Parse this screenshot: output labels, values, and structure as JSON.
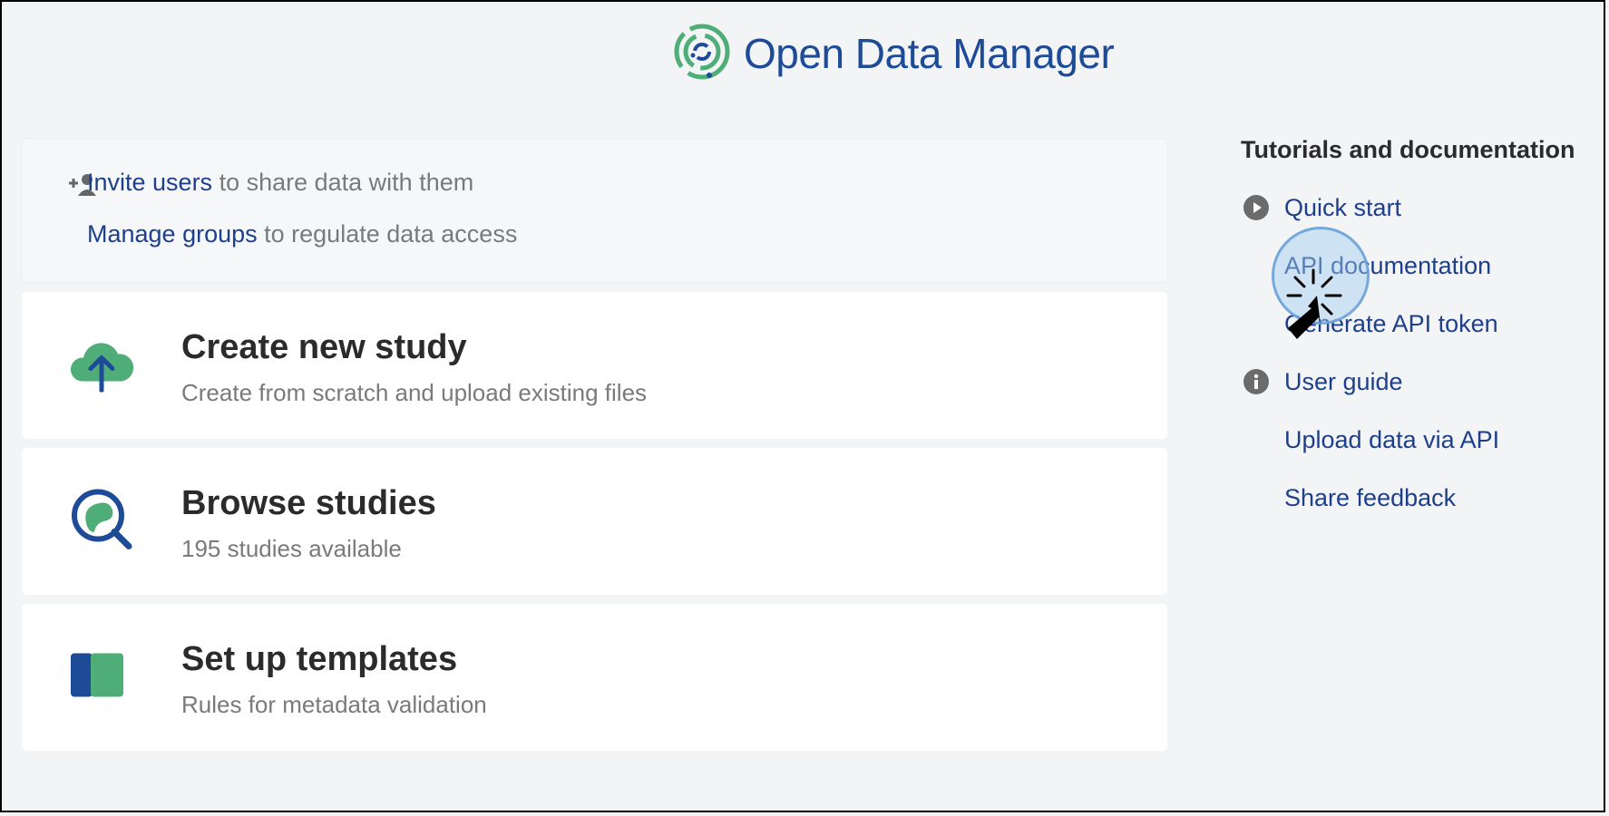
{
  "brand": {
    "title": "Open Data Manager",
    "logo_icon": "concentric-rings-logo",
    "color": "#1e4b98",
    "accent": "#4fae78"
  },
  "invite_card": {
    "invite_link": "Invite users",
    "invite_rest": " to share data with them",
    "groups_link": "Manage groups",
    "groups_rest": " to regulate data access"
  },
  "cards": [
    {
      "title": "Create new study",
      "subtitle": "Create from scratch and upload existing files",
      "icon": "cloud-upload-icon"
    },
    {
      "title": "Browse studies",
      "subtitle": "195 studies available",
      "icon": "search-study-icon"
    },
    {
      "title": "Set up templates",
      "subtitle": "Rules for metadata validation",
      "icon": "template-icon"
    }
  ],
  "sidebar": {
    "title": "Tutorials and documentation",
    "items": [
      {
        "label": "Quick start",
        "icon": "play-circle-icon"
      },
      {
        "label": "API documentation",
        "icon": ""
      },
      {
        "label": "Generate API token",
        "icon": ""
      },
      {
        "label": "User guide",
        "icon": "info-circle-icon"
      },
      {
        "label": "Upload data via API",
        "icon": ""
      },
      {
        "label": "Share feedback",
        "icon": ""
      }
    ]
  }
}
